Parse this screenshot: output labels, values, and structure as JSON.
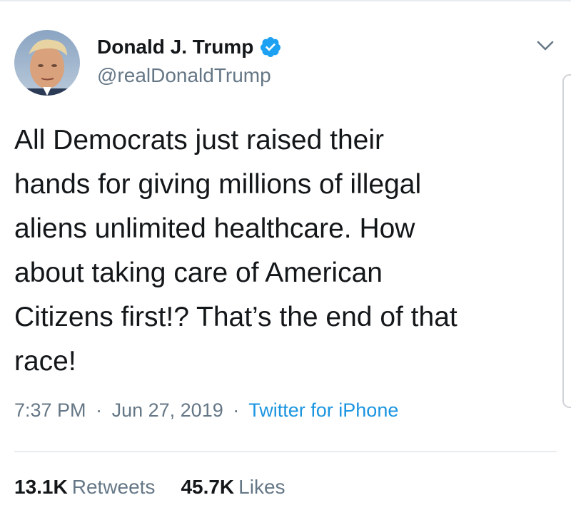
{
  "author": {
    "name": "Donald J. Trump",
    "handle": "@realDonaldTrump",
    "verified": true
  },
  "tweet": {
    "text": "All Democrats just raised their\nhands for giving millions of illegal\naliens unlimited healthcare. How\nabout taking care of American\nCitizens first!? That’s the end of that\nrace!",
    "time": "7:37 PM",
    "separator": "·",
    "date": "Jun 27, 2019",
    "source": "Twitter for iPhone"
  },
  "stats": {
    "retweets_count": "13.1K",
    "retweets_label": "Retweets",
    "likes_count": "45.7K",
    "likes_label": "Likes"
  },
  "colors": {
    "text_primary": "#14171a",
    "text_secondary": "#657786",
    "link": "#1b95e0",
    "verified": "#1da1f2",
    "divider": "#e6ecf0"
  },
  "icons": {
    "verified": "verified-badge-icon",
    "caret": "chevron-down-icon"
  }
}
